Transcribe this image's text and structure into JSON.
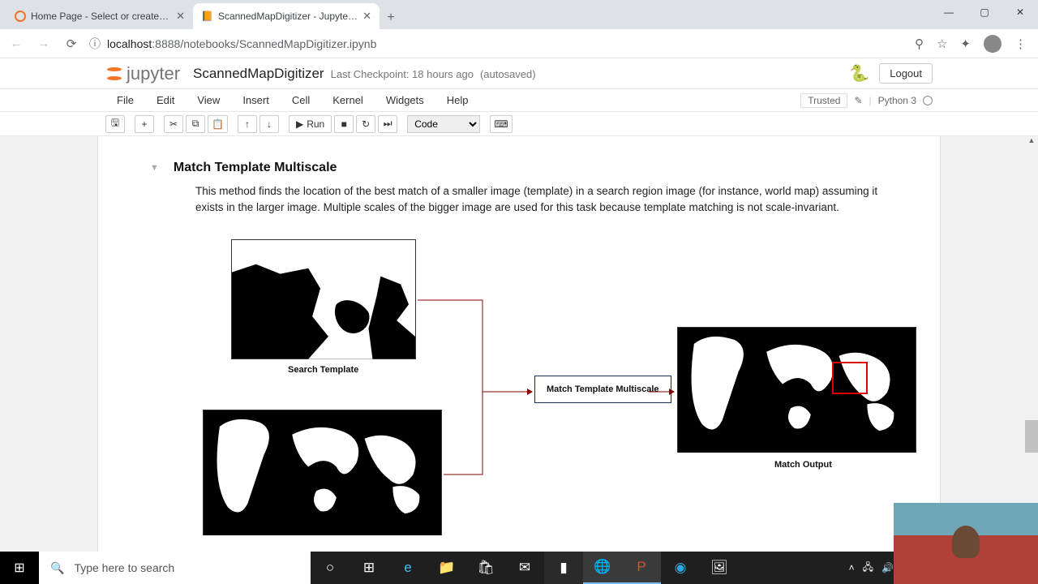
{
  "browser": {
    "tabs": [
      {
        "title": "Home Page - Select or create a n",
        "active": false
      },
      {
        "title": "ScannedMapDigitizer - Jupyter N",
        "active": true
      }
    ],
    "url_host": "localhost",
    "url_port": ":8888",
    "url_path": "/notebooks/ScannedMapDigitizer.ipynb"
  },
  "jupyter": {
    "logo_text": "jupyter",
    "notebook_name": "ScannedMapDigitizer",
    "checkpoint": "Last Checkpoint: 18 hours ago",
    "autosave": "(autosaved)",
    "logout": "Logout",
    "menus": [
      "File",
      "Edit",
      "View",
      "Insert",
      "Cell",
      "Kernel",
      "Widgets",
      "Help"
    ],
    "trusted": "Trusted",
    "kernel": "Python 3",
    "run_label": "Run",
    "celltype": "Code"
  },
  "content": {
    "heading": "Match Template Multiscale",
    "body": "This method finds the location of the best match of a smaller image (template) in a search region image (for instance, world map) assuming it exists in the larger image. Multiple scales of the bigger image are used for this task because template matching is not scale-invariant.",
    "caption_template": "Search Template",
    "caption_output": "Match Output",
    "algo_label": "Match Template Multiscale"
  },
  "taskbar": {
    "search_placeholder": "Type here to search"
  }
}
